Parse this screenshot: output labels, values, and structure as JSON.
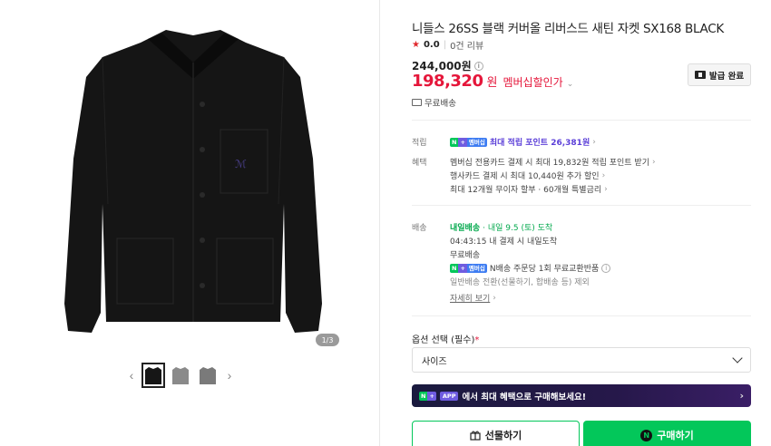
{
  "gallery": {
    "page_indicator": "1/3",
    "thumbnails": [
      "front",
      "back-gray",
      "side-gray"
    ]
  },
  "product": {
    "title": "니들스 26SS 블랙 커버올 리버스드 새틴 자켓 SX168 BLACK",
    "rating": "0.0",
    "reviews": "0건 리뷰",
    "original_price": "244,000원",
    "sale_price": "198,320",
    "sale_currency": "원",
    "sale_label": "멤버십할인가",
    "coupon_button": "발급 완료",
    "shipping_top": "무료배송"
  },
  "benefits": {
    "points_label": "적립",
    "points_text": "최대 적립 포인트 26,381원",
    "benefit_label": "혜택",
    "benefit_lines": [
      "멤버십 전용카드 결제 시 최대 19,832원 적립 포인트 받기",
      "행사카드 결제 시 최대 10,440원 추가 할인",
      "최대 12개월 무이자 할부 · 60개월 특별금리"
    ]
  },
  "delivery": {
    "label": "배송",
    "tomorrow_badge": "내일배송",
    "tomorrow_text": "· 내일 9.5 (토) 도착",
    "order_deadline": "04:43:15  내 결제 시 내일도착",
    "free": "무료배송",
    "exchange": "N배송 주문당 1회 무료교환반품",
    "general": "일반배송 전환(선물하기, 합배송 등) 제외",
    "detail_link": "자세히 보기"
  },
  "options": {
    "label": "옵션 선택 (필수)",
    "required_mark": "*",
    "size_placeholder": "사이즈"
  },
  "banner": {
    "app_tag": "APP",
    "text": "에서 최대 혜택으로 구매해보세요!"
  },
  "buttons": {
    "gift": "선물하기",
    "buy": "구매하기"
  },
  "badges": {
    "n": "N",
    "plus": "+",
    "membership": "멤버십"
  },
  "colors": {
    "sale": "#e5163a",
    "naver_green": "#03c75a",
    "purple": "#5b3fd8"
  }
}
